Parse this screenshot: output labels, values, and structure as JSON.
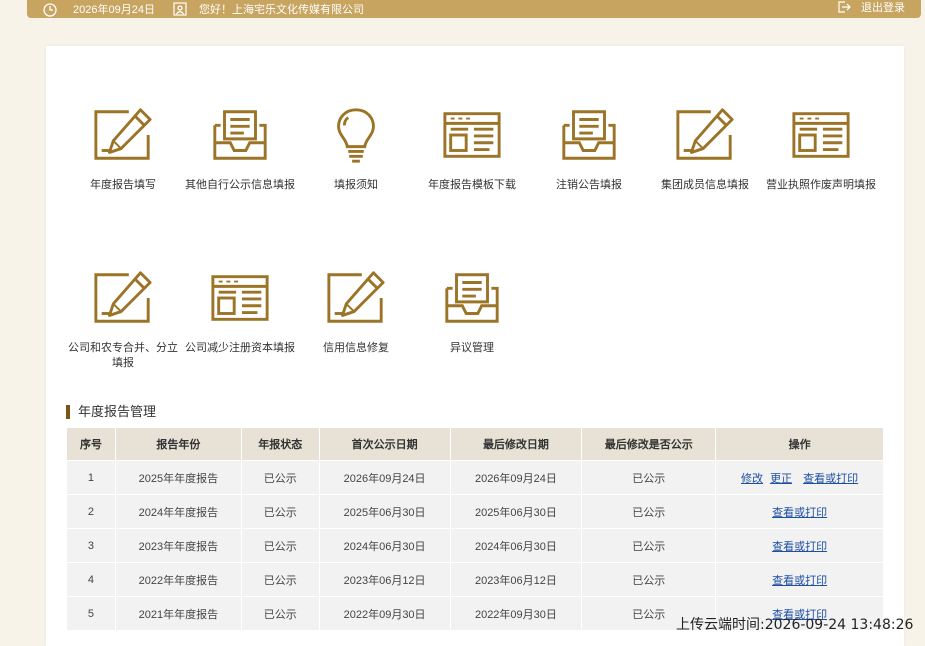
{
  "header": {
    "date": "2026年09月24日",
    "greeting": "您好！上海宅乐文化传媒有限公司",
    "logout": "退出登录"
  },
  "tiles": [
    {
      "label": "年度报告填写",
      "icon": "pencil-edit-icon"
    },
    {
      "label": "其他自行公示信息填报",
      "icon": "inbox-document-icon"
    },
    {
      "label": "填报须知",
      "icon": "lightbulb-icon"
    },
    {
      "label": "年度报告模板下载",
      "icon": "form-window-icon"
    },
    {
      "label": "注销公告填报",
      "icon": "inbox-document-icon"
    },
    {
      "label": "集团成员信息填报",
      "icon": "pencil-edit-icon"
    },
    {
      "label": "营业执照作废声明填报",
      "icon": "form-window-icon"
    },
    {
      "label": "公司和农专合并、分立填报",
      "icon": "pencil-edit-icon"
    },
    {
      "label": "公司减少注册资本填报",
      "icon": "form-window-icon"
    },
    {
      "label": "信用信息修复",
      "icon": "pencil-edit-icon"
    },
    {
      "label": "异议管理",
      "icon": "inbox-document-icon"
    }
  ],
  "section_title": "年度报告管理",
  "table": {
    "headers": [
      "序号",
      "报告年份",
      "年报状态",
      "首次公示日期",
      "最后修改日期",
      "最后修改是否公示",
      "操作"
    ],
    "rows": [
      {
        "no": "1",
        "year": "2025年年度报告",
        "status": "已公示",
        "first": "2026年09月24日",
        "last": "2026年09月24日",
        "pub": "已公示",
        "actions": [
          "修改",
          "更正",
          "查看或打印"
        ]
      },
      {
        "no": "2",
        "year": "2024年年度报告",
        "status": "已公示",
        "first": "2025年06月30日",
        "last": "2025年06月30日",
        "pub": "已公示",
        "actions": [
          "查看或打印"
        ]
      },
      {
        "no": "3",
        "year": "2023年年度报告",
        "status": "已公示",
        "first": "2024年06月30日",
        "last": "2024年06月30日",
        "pub": "已公示",
        "actions": [
          "查看或打印"
        ]
      },
      {
        "no": "4",
        "year": "2022年年度报告",
        "status": "已公示",
        "first": "2023年06月12日",
        "last": "2023年06月12日",
        "pub": "已公示",
        "actions": [
          "查看或打印"
        ]
      },
      {
        "no": "5",
        "year": "2021年年度报告",
        "status": "已公示",
        "first": "2022年09月30日",
        "last": "2022年09月30日",
        "pub": "已公示",
        "actions": [
          "查看或打印"
        ]
      }
    ]
  },
  "watermark": "上传云端时间:2026-09-24 13:48:26",
  "colors": {
    "gold": "#c7a45f",
    "icon_brown": "#9b7427",
    "link_blue": "#1e4fa1",
    "header_bg": "#e8e1d5"
  }
}
